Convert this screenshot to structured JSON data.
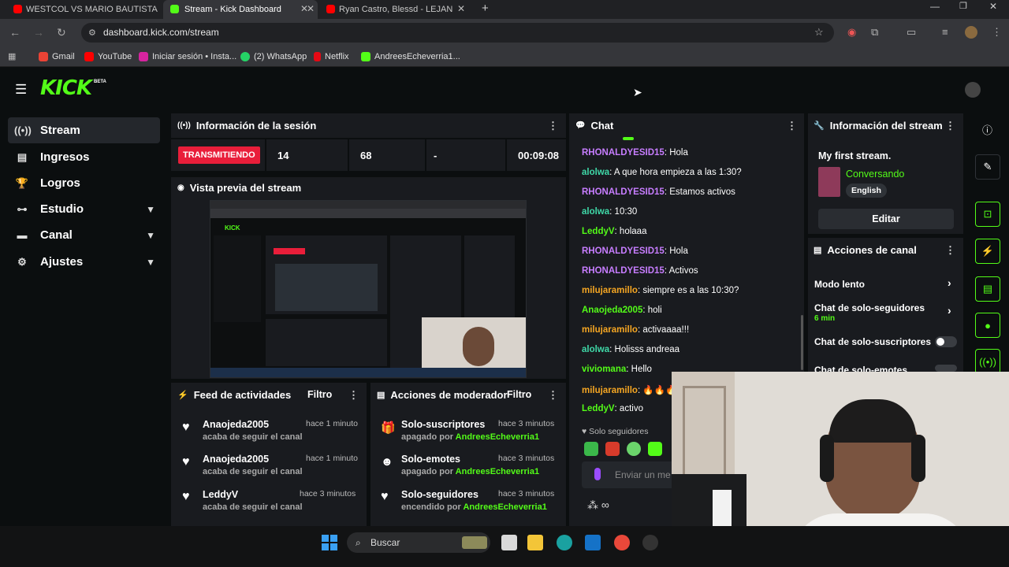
{
  "browser": {
    "tabs": [
      {
        "title": "WESTCOL VS MARIO BAUTISTA",
        "color": "#ff0000"
      },
      {
        "title": "Stream - Kick Dashboard",
        "color": "#53fc18"
      },
      {
        "title": "Ryan Castro, Blessd - LEJAN",
        "color": "#ff0000"
      }
    ],
    "url": "dashboard.kick.com/stream",
    "bookmarks": [
      {
        "label": "Gmail",
        "color": "#ea4335"
      },
      {
        "label": "YouTube",
        "color": "#ff0000"
      },
      {
        "label": "Iniciar sesión • Insta...",
        "color": "#d6249f"
      },
      {
        "label": "(2) WhatsApp",
        "color": "#25d366"
      },
      {
        "label": "Netflix",
        "color": "#e50914"
      },
      {
        "label": "AndreesEcheverria1...",
        "color": "#53fc18"
      }
    ]
  },
  "kick": {
    "logo": "KICK",
    "beta": "BETA",
    "accent": "#53fc18"
  },
  "sidebar": {
    "items": [
      {
        "label": "Stream",
        "icon": "broadcast-icon"
      },
      {
        "label": "Ingresos",
        "icon": "money-icon"
      },
      {
        "label": "Logros",
        "icon": "trophy-icon"
      },
      {
        "label": "Estudio",
        "icon": "studio-icon"
      },
      {
        "label": "Canal",
        "icon": "channel-icon"
      },
      {
        "label": "Ajustes",
        "icon": "gear-icon"
      }
    ]
  },
  "session": {
    "title": "Información de la sesión",
    "live_badge": "TRANSMITIENDO",
    "viewers": "14",
    "followers": "68",
    "subs": "-",
    "duration": "00:09:08"
  },
  "preview": {
    "title": "Vista previa del stream"
  },
  "feed": {
    "title": "Feed de actividades",
    "filter": "Filtro",
    "items": [
      {
        "name": "Anaojeda2005",
        "sub": "acaba de seguir el canal",
        "time": "hace 1 minuto"
      },
      {
        "name": "Anaojeda2005",
        "sub": "acaba de seguir el canal",
        "time": "hace 1 minuto"
      },
      {
        "name": "LeddyV",
        "sub": "acaba de seguir el canal",
        "time": "hace 3 minutos"
      }
    ]
  },
  "modactions": {
    "title": "Acciones de moderador",
    "filter": "Filtro",
    "items": [
      {
        "name": "Solo-suscriptores",
        "state": "apagado por",
        "by": "AndreesEcheverria1",
        "time": "hace 3 minutos"
      },
      {
        "name": "Solo-emotes",
        "state": "apagado por",
        "by": "AndreesEcheverria1",
        "time": "hace 3 minutos"
      },
      {
        "name": "Solo-seguidores",
        "state": "encendido por",
        "by": "AndreesEcheverria1",
        "time": "hace 3 minutos"
      }
    ]
  },
  "chat": {
    "title": "Chat",
    "messages": [
      {
        "user": "RHONALDYESID15",
        "text": ": Hola",
        "cls": "u-p"
      },
      {
        "user": "alolwa",
        "text": ": A que hora empieza a las 1:30?",
        "cls": "u-t"
      },
      {
        "user": "RHONALDYESID15",
        "text": ": Estamos activos",
        "cls": "u-p"
      },
      {
        "user": "alolwa",
        "text": ": 10:30",
        "cls": "u-t"
      },
      {
        "user": "LeddyV",
        "text": ": holaaa",
        "cls": "u-g"
      },
      {
        "user": "RHONALDYESID15",
        "text": ": Hola",
        "cls": "u-p"
      },
      {
        "user": "RHONALDYESID15",
        "text": ": Activos",
        "cls": "u-p"
      },
      {
        "user": "milujaramillo",
        "text": ": siempre es a las 10:30?",
        "cls": "u-o"
      },
      {
        "user": "Anaojeda2005",
        "text": ": holi",
        "cls": "u-g"
      },
      {
        "user": "milujaramillo",
        "text": ": activaaaa!!!",
        "cls": "u-o"
      },
      {
        "user": "alolwa",
        "text": ": Holisss andreaa",
        "cls": "u-t"
      },
      {
        "user": "viviomana",
        "text": ": Hello",
        "cls": "u-g"
      },
      {
        "user": "milujaramillo",
        "text": ": 🔥🔥🔥",
        "cls": "u-o"
      },
      {
        "user": "LeddyV",
        "text": ": activo",
        "cls": "u-g"
      }
    ],
    "followers_only": "Solo seguidores",
    "input_placeholder": "Enviar un me"
  },
  "streaminfo": {
    "title": "Información del stream",
    "stream_title": "My first stream.",
    "category": "Conversando",
    "language": "English",
    "edit": "Editar"
  },
  "channelactions": {
    "title": "Acciones de canal",
    "slow_mode": "Modo lento",
    "followers_only": "Chat de solo-seguidores",
    "followers_time": "6 min",
    "subs_only": "Chat de solo-suscriptores",
    "emotes_only": "Chat de solo-emotes"
  },
  "taskbar": {
    "search": "Buscar"
  }
}
